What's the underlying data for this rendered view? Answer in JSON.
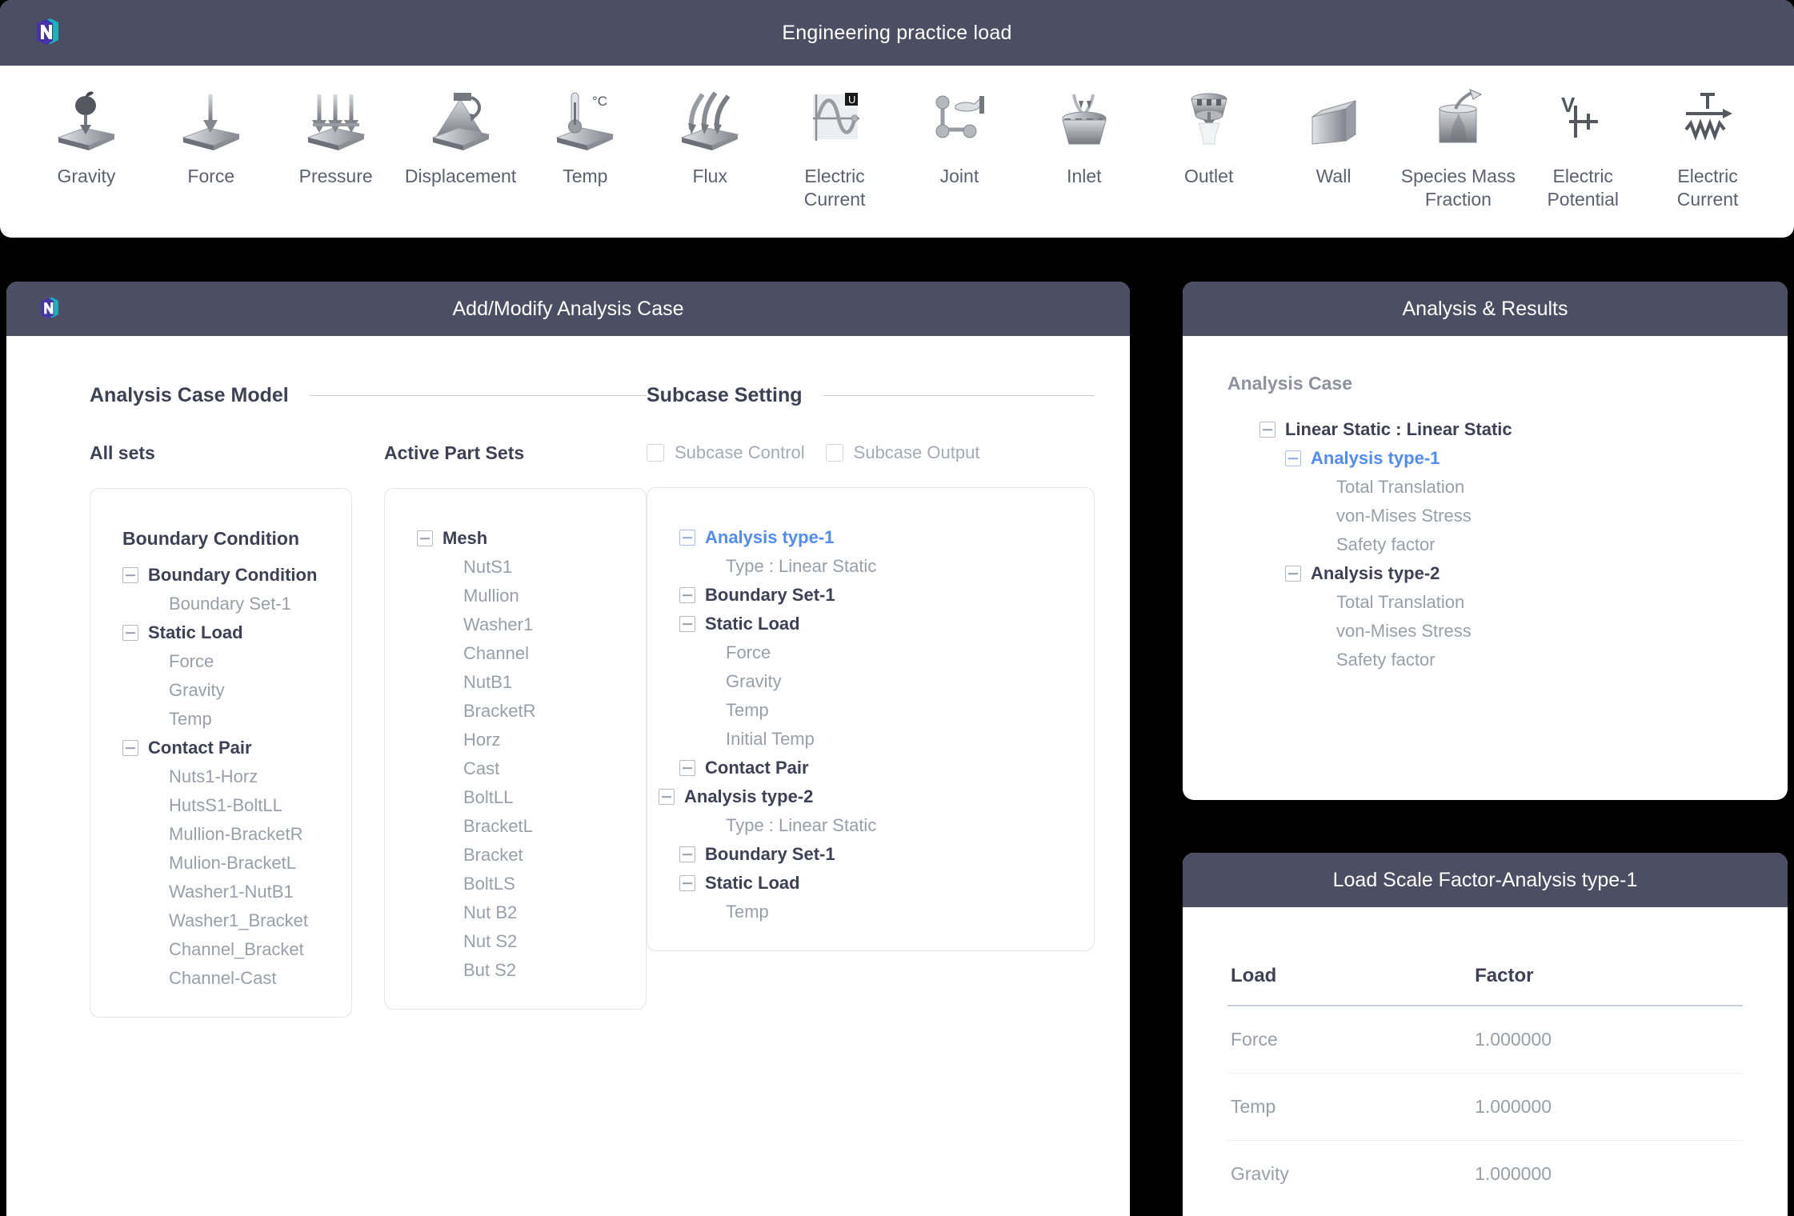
{
  "app": {
    "title": "Engineering practice load",
    "logo_icon": "nexus-n-logo",
    "brand_colors": {
      "left": "#4733a8",
      "right": "#17b3bd",
      "accent_blue": "#4f8cf7",
      "header_bg": "#4c4f63"
    }
  },
  "toolbar": {
    "items": [
      {
        "label": "Gravity",
        "icon": "gravity-icon"
      },
      {
        "label": "Force",
        "icon": "force-icon"
      },
      {
        "label": "Pressure",
        "icon": "pressure-icon"
      },
      {
        "label": "Displacement",
        "icon": "displacement-icon"
      },
      {
        "label": "Temp",
        "icon": "temperature-icon"
      },
      {
        "label": "Flux",
        "icon": "flux-icon"
      },
      {
        "label": "Electric Current",
        "icon": "electric-current-graph-icon"
      },
      {
        "label": "Joint",
        "icon": "joint-icon"
      },
      {
        "label": "Inlet",
        "icon": "inlet-icon"
      },
      {
        "label": "Outlet",
        "icon": "outlet-icon"
      },
      {
        "label": "Wall",
        "icon": "wall-icon"
      },
      {
        "label": "Species Mass Fraction",
        "icon": "species-mass-fraction-icon"
      },
      {
        "label": "Electric Potential",
        "icon": "electric-potential-icon"
      },
      {
        "label": "Electric Current",
        "icon": "electric-current-circuit-icon"
      }
    ]
  },
  "left_panel": {
    "header_title": "Add/Modify Analysis Case",
    "analysis_case_model": {
      "section_title": "Analysis Case Model",
      "all_sets": {
        "label": "All sets",
        "tree": [
          {
            "text": "Boundary Condition",
            "type": "header",
            "indent": 0
          },
          {
            "text": "Boundary Condition",
            "type": "node",
            "indent": 0
          },
          {
            "text": "Boundary Set-1",
            "type": "leaf",
            "indent": 1
          },
          {
            "text": "Static Load",
            "type": "node",
            "indent": 0
          },
          {
            "text": "Force",
            "type": "leaf",
            "indent": 1
          },
          {
            "text": "Gravity",
            "type": "leaf",
            "indent": 1
          },
          {
            "text": "Temp",
            "type": "leaf",
            "indent": 1
          },
          {
            "text": "Contact Pair",
            "type": "node",
            "indent": 0
          },
          {
            "text": "Nuts1-Horz",
            "type": "leaf",
            "indent": 1
          },
          {
            "text": "HutsS1-BoltLL",
            "type": "leaf",
            "indent": 1
          },
          {
            "text": "Mullion-BracketR",
            "type": "leaf",
            "indent": 1
          },
          {
            "text": "Mulion-BracketL",
            "type": "leaf",
            "indent": 1
          },
          {
            "text": "Washer1-NutB1",
            "type": "leaf",
            "indent": 1
          },
          {
            "text": "Washer1_Bracket",
            "type": "leaf",
            "indent": 1
          },
          {
            "text": "Channel_Bracket",
            "type": "leaf",
            "indent": 1
          },
          {
            "text": "Channel-Cast",
            "type": "leaf",
            "indent": 1
          }
        ]
      },
      "active_part_sets": {
        "label": "Active Part Sets",
        "tree": [
          {
            "text": "Mesh",
            "type": "node",
            "indent": 0
          },
          {
            "text": "NutS1",
            "type": "leaf",
            "indent": 1
          },
          {
            "text": "Mullion",
            "type": "leaf",
            "indent": 1
          },
          {
            "text": "Washer1",
            "type": "leaf",
            "indent": 1
          },
          {
            "text": "Channel",
            "type": "leaf",
            "indent": 1
          },
          {
            "text": "NutB1",
            "type": "leaf",
            "indent": 1
          },
          {
            "text": "BracketR",
            "type": "leaf",
            "indent": 1
          },
          {
            "text": "Horz",
            "type": "leaf",
            "indent": 1
          },
          {
            "text": "Cast",
            "type": "leaf",
            "indent": 1
          },
          {
            "text": "BoltLL",
            "type": "leaf",
            "indent": 1
          },
          {
            "text": "BracketL",
            "type": "leaf",
            "indent": 1
          },
          {
            "text": "Bracket",
            "type": "leaf",
            "indent": 1
          },
          {
            "text": "BoltLS",
            "type": "leaf",
            "indent": 1
          },
          {
            "text": "Nut B2",
            "type": "leaf",
            "indent": 1
          },
          {
            "text": "Nut S2",
            "type": "leaf",
            "indent": 1
          },
          {
            "text": "But S2",
            "type": "leaf",
            "indent": 1
          }
        ]
      }
    },
    "subcase_setting": {
      "section_title": "Subcase Setting",
      "checkboxes": [
        {
          "label": "Subcase Control",
          "checked": false
        },
        {
          "label": "Subcase Output",
          "checked": false
        }
      ],
      "tree": [
        {
          "text": "Analysis type-1",
          "type": "blue",
          "indent": 0
        },
        {
          "text": "Type : Linear Static",
          "type": "leaf",
          "indent": 1
        },
        {
          "text": "Boundary Set-1",
          "type": "node",
          "indent": 0
        },
        {
          "text": "Static Load",
          "type": "node",
          "indent": 0
        },
        {
          "text": "Force",
          "type": "leaf",
          "indent": 1
        },
        {
          "text": "Gravity",
          "type": "leaf",
          "indent": 1
        },
        {
          "text": "Temp",
          "type": "leaf",
          "indent": 1
        },
        {
          "text": "Initial Temp",
          "type": "leaf",
          "indent": 1
        },
        {
          "text": "Contact Pair",
          "type": "node",
          "indent": 0
        },
        {
          "text": "Analysis type-2",
          "type": "node",
          "indent": -1
        },
        {
          "text": "Type : Linear Static",
          "type": "leaf",
          "indent": 1
        },
        {
          "text": "Boundary Set-1",
          "type": "node",
          "indent": 0
        },
        {
          "text": "Static Load",
          "type": "node",
          "indent": 0
        },
        {
          "text": "Temp",
          "type": "leaf",
          "indent": 1
        }
      ]
    }
  },
  "right_top_panel": {
    "header_title": "Analysis & Results",
    "group_label": "Analysis Case",
    "tree": [
      {
        "text": "Linear Static : Linear Static",
        "type": "node",
        "indent": 0
      },
      {
        "text": "Analysis type-1",
        "type": "blue",
        "indent": 1
      },
      {
        "text": "Total Translation",
        "type": "leaf",
        "indent": 2
      },
      {
        "text": "von-Mises Stress",
        "type": "leaf",
        "indent": 2
      },
      {
        "text": "Safety factor",
        "type": "leaf",
        "indent": 2
      },
      {
        "text": "Analysis type-2",
        "type": "node",
        "indent": 1
      },
      {
        "text": "Total Translation",
        "type": "leaf",
        "indent": 2
      },
      {
        "text": "von-Mises Stress",
        "type": "leaf",
        "indent": 2
      },
      {
        "text": "Safety factor",
        "type": "leaf",
        "indent": 2
      }
    ]
  },
  "right_bottom_panel": {
    "header_title": "Load Scale Factor-Analysis type-1",
    "columns": [
      "Load",
      "Factor"
    ],
    "rows": [
      {
        "load": "Force",
        "factor": "1.000000"
      },
      {
        "load": "Temp",
        "factor": "1.000000"
      },
      {
        "load": "Gravity",
        "factor": "1.000000"
      }
    ]
  }
}
